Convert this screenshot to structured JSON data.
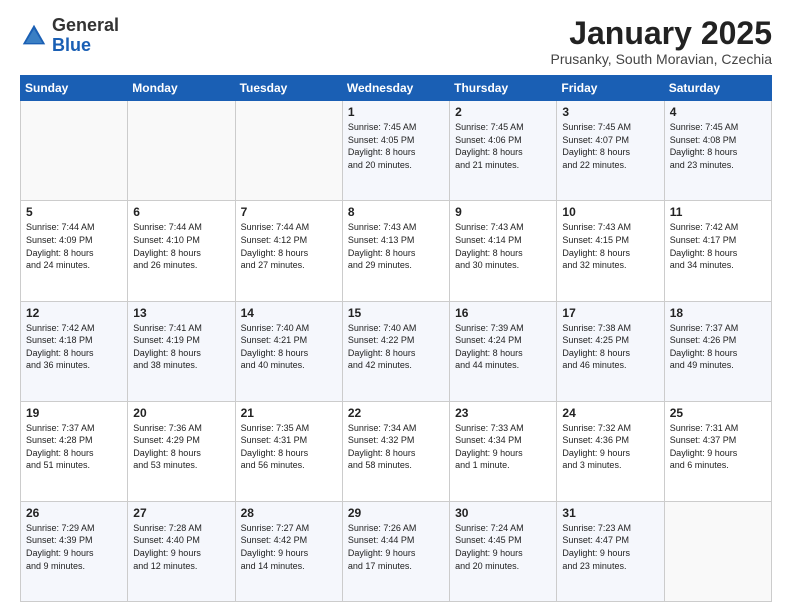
{
  "logo": {
    "general": "General",
    "blue": "Blue"
  },
  "header": {
    "month": "January 2025",
    "location": "Prusanky, South Moravian, Czechia"
  },
  "days_of_week": [
    "Sunday",
    "Monday",
    "Tuesday",
    "Wednesday",
    "Thursday",
    "Friday",
    "Saturday"
  ],
  "weeks": [
    [
      {
        "day": "",
        "info": ""
      },
      {
        "day": "",
        "info": ""
      },
      {
        "day": "",
        "info": ""
      },
      {
        "day": "1",
        "info": "Sunrise: 7:45 AM\nSunset: 4:05 PM\nDaylight: 8 hours\nand 20 minutes."
      },
      {
        "day": "2",
        "info": "Sunrise: 7:45 AM\nSunset: 4:06 PM\nDaylight: 8 hours\nand 21 minutes."
      },
      {
        "day": "3",
        "info": "Sunrise: 7:45 AM\nSunset: 4:07 PM\nDaylight: 8 hours\nand 22 minutes."
      },
      {
        "day": "4",
        "info": "Sunrise: 7:45 AM\nSunset: 4:08 PM\nDaylight: 8 hours\nand 23 minutes."
      }
    ],
    [
      {
        "day": "5",
        "info": "Sunrise: 7:44 AM\nSunset: 4:09 PM\nDaylight: 8 hours\nand 24 minutes."
      },
      {
        "day": "6",
        "info": "Sunrise: 7:44 AM\nSunset: 4:10 PM\nDaylight: 8 hours\nand 26 minutes."
      },
      {
        "day": "7",
        "info": "Sunrise: 7:44 AM\nSunset: 4:12 PM\nDaylight: 8 hours\nand 27 minutes."
      },
      {
        "day": "8",
        "info": "Sunrise: 7:43 AM\nSunset: 4:13 PM\nDaylight: 8 hours\nand 29 minutes."
      },
      {
        "day": "9",
        "info": "Sunrise: 7:43 AM\nSunset: 4:14 PM\nDaylight: 8 hours\nand 30 minutes."
      },
      {
        "day": "10",
        "info": "Sunrise: 7:43 AM\nSunset: 4:15 PM\nDaylight: 8 hours\nand 32 minutes."
      },
      {
        "day": "11",
        "info": "Sunrise: 7:42 AM\nSunset: 4:17 PM\nDaylight: 8 hours\nand 34 minutes."
      }
    ],
    [
      {
        "day": "12",
        "info": "Sunrise: 7:42 AM\nSunset: 4:18 PM\nDaylight: 8 hours\nand 36 minutes."
      },
      {
        "day": "13",
        "info": "Sunrise: 7:41 AM\nSunset: 4:19 PM\nDaylight: 8 hours\nand 38 minutes."
      },
      {
        "day": "14",
        "info": "Sunrise: 7:40 AM\nSunset: 4:21 PM\nDaylight: 8 hours\nand 40 minutes."
      },
      {
        "day": "15",
        "info": "Sunrise: 7:40 AM\nSunset: 4:22 PM\nDaylight: 8 hours\nand 42 minutes."
      },
      {
        "day": "16",
        "info": "Sunrise: 7:39 AM\nSunset: 4:24 PM\nDaylight: 8 hours\nand 44 minutes."
      },
      {
        "day": "17",
        "info": "Sunrise: 7:38 AM\nSunset: 4:25 PM\nDaylight: 8 hours\nand 46 minutes."
      },
      {
        "day": "18",
        "info": "Sunrise: 7:37 AM\nSunset: 4:26 PM\nDaylight: 8 hours\nand 49 minutes."
      }
    ],
    [
      {
        "day": "19",
        "info": "Sunrise: 7:37 AM\nSunset: 4:28 PM\nDaylight: 8 hours\nand 51 minutes."
      },
      {
        "day": "20",
        "info": "Sunrise: 7:36 AM\nSunset: 4:29 PM\nDaylight: 8 hours\nand 53 minutes."
      },
      {
        "day": "21",
        "info": "Sunrise: 7:35 AM\nSunset: 4:31 PM\nDaylight: 8 hours\nand 56 minutes."
      },
      {
        "day": "22",
        "info": "Sunrise: 7:34 AM\nSunset: 4:32 PM\nDaylight: 8 hours\nand 58 minutes."
      },
      {
        "day": "23",
        "info": "Sunrise: 7:33 AM\nSunset: 4:34 PM\nDaylight: 9 hours\nand 1 minute."
      },
      {
        "day": "24",
        "info": "Sunrise: 7:32 AM\nSunset: 4:36 PM\nDaylight: 9 hours\nand 3 minutes."
      },
      {
        "day": "25",
        "info": "Sunrise: 7:31 AM\nSunset: 4:37 PM\nDaylight: 9 hours\nand 6 minutes."
      }
    ],
    [
      {
        "day": "26",
        "info": "Sunrise: 7:29 AM\nSunset: 4:39 PM\nDaylight: 9 hours\nand 9 minutes."
      },
      {
        "day": "27",
        "info": "Sunrise: 7:28 AM\nSunset: 4:40 PM\nDaylight: 9 hours\nand 12 minutes."
      },
      {
        "day": "28",
        "info": "Sunrise: 7:27 AM\nSunset: 4:42 PM\nDaylight: 9 hours\nand 14 minutes."
      },
      {
        "day": "29",
        "info": "Sunrise: 7:26 AM\nSunset: 4:44 PM\nDaylight: 9 hours\nand 17 minutes."
      },
      {
        "day": "30",
        "info": "Sunrise: 7:24 AM\nSunset: 4:45 PM\nDaylight: 9 hours\nand 20 minutes."
      },
      {
        "day": "31",
        "info": "Sunrise: 7:23 AM\nSunset: 4:47 PM\nDaylight: 9 hours\nand 23 minutes."
      },
      {
        "day": "",
        "info": ""
      }
    ]
  ]
}
